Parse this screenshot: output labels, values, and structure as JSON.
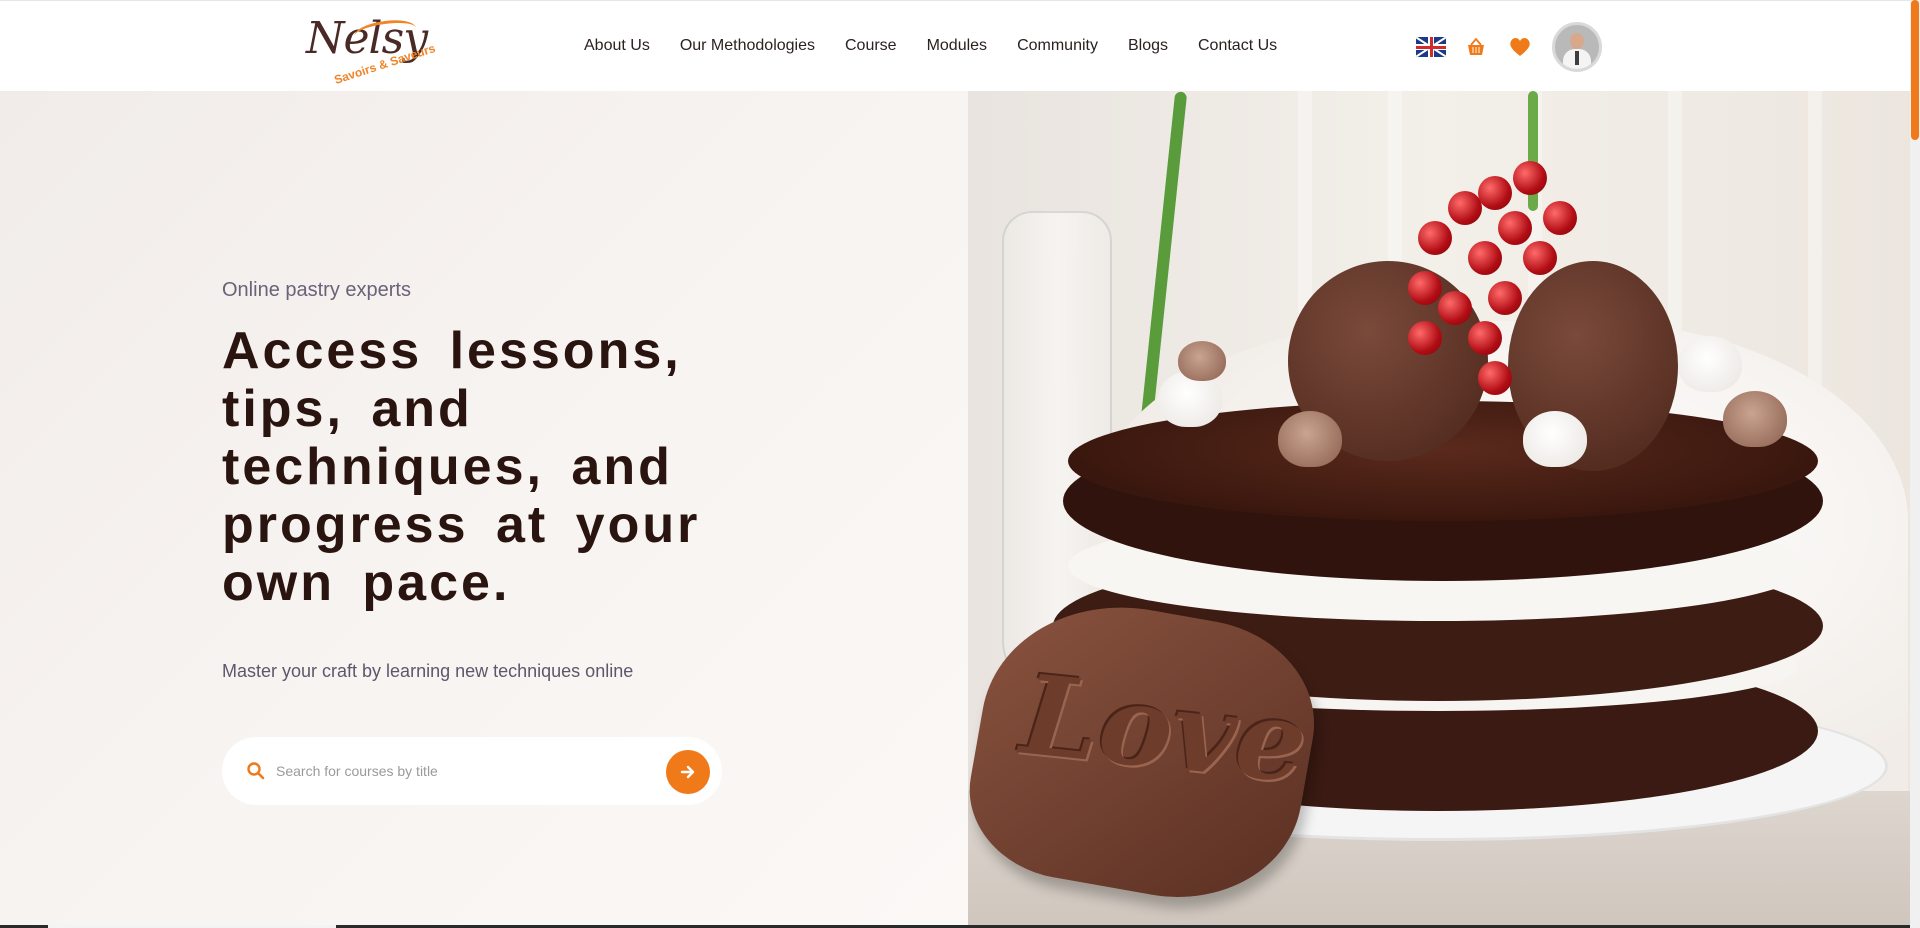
{
  "brand": {
    "name": "Nelsy",
    "tagline": "Savoirs & Saveurs",
    "accent_color": "#f07a1a",
    "text_color": "#2a1410"
  },
  "nav": {
    "items": [
      {
        "label": "About Us"
      },
      {
        "label": "Our Methodologies"
      },
      {
        "label": "Course"
      },
      {
        "label": "Modules"
      },
      {
        "label": "Community"
      },
      {
        "label": "Blogs"
      },
      {
        "label": "Contact Us"
      }
    ]
  },
  "header_icons": {
    "language": "uk-flag-icon",
    "cart": "basket-icon",
    "favorites": "heart-icon",
    "profile": "avatar"
  },
  "hero": {
    "eyebrow": "Online pastry experts",
    "headline": "Access lessons, tips, and techniques, and progress at your own pace.",
    "subline": "Master your craft by learning new techniques online",
    "image_text": "Love"
  },
  "search": {
    "placeholder": "Search for courses by title",
    "value": ""
  }
}
